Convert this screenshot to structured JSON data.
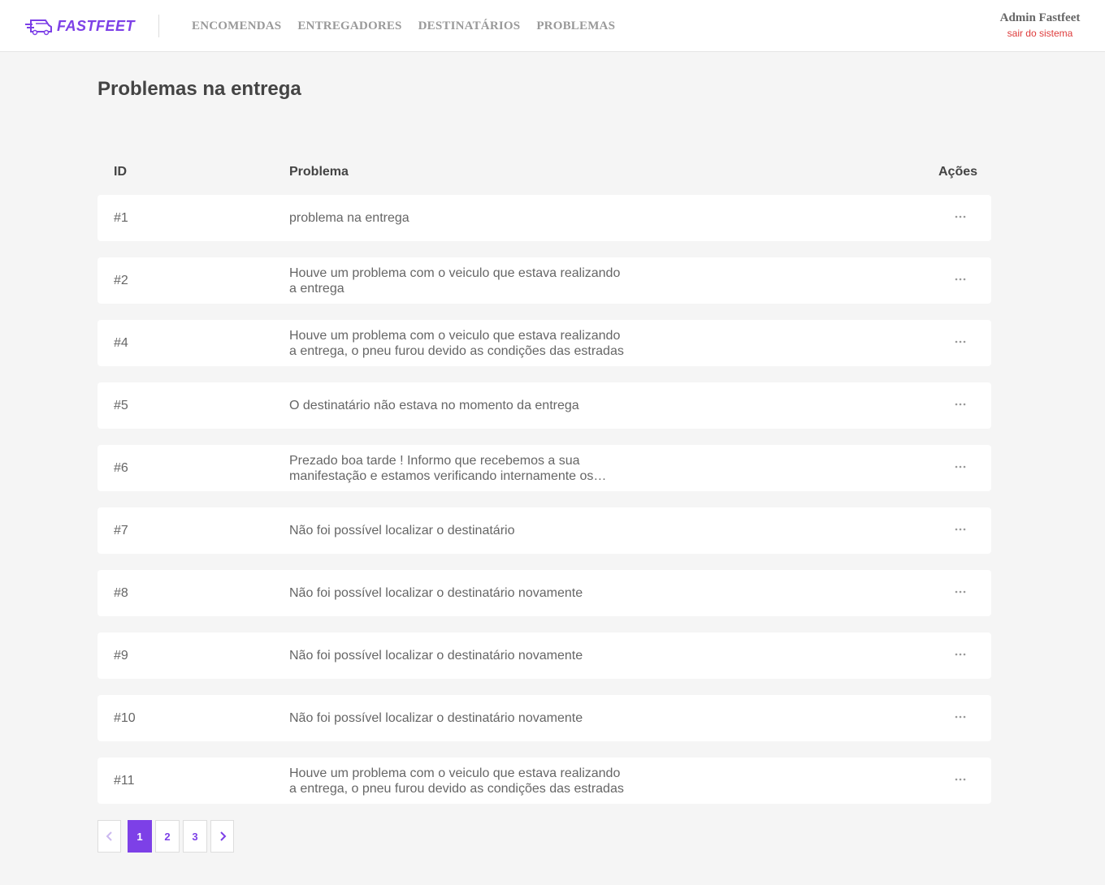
{
  "app": {
    "logo_text": "FASTFEET",
    "brand_color": "#7d40e7"
  },
  "nav": {
    "items": [
      {
        "label": "ENCOMENDAS"
      },
      {
        "label": "ENTREGADORES"
      },
      {
        "label": "DESTINATÁRIOS"
      },
      {
        "label": "PROBLEMAS"
      }
    ]
  },
  "user": {
    "name": "Admin Fastfeet",
    "logout_label": "sair do sistema"
  },
  "page": {
    "title": "Problemas na entrega"
  },
  "table": {
    "headers": {
      "id": "ID",
      "problem": "Problema",
      "actions": "Ações"
    },
    "actions_icon": "more-horizontal-icon",
    "rows": [
      {
        "id": "#1",
        "problem": "problema na entrega"
      },
      {
        "id": "#2",
        "problem": "Houve um problema com o veiculo que estava realizando a entrega"
      },
      {
        "id": "#4",
        "problem": "Houve um problema com o veiculo que estava realizando a entrega, o pneu furou devido as condições das estradas"
      },
      {
        "id": "#5",
        "problem": "O destinatário não estava no momento da entrega"
      },
      {
        "id": "#6",
        "problem": "Prezado boa tarde !   Informo que recebemos a sua manifestação e estamos verificando internamente os…"
      },
      {
        "id": "#7",
        "problem": "Não foi possível localizar o destinatário"
      },
      {
        "id": "#8",
        "problem": "Não foi possível localizar o destinatário novamente"
      },
      {
        "id": "#9",
        "problem": "Não foi possível localizar o destinatário novamente"
      },
      {
        "id": "#10",
        "problem": "Não foi possível localizar o destinatário novamente"
      },
      {
        "id": "#11",
        "problem": "Houve um problema com o veiculo que estava realizando a entrega, o pneu furou devido as condições das estradas"
      }
    ]
  },
  "pagination": {
    "pages": [
      "1",
      "2",
      "3"
    ],
    "current": "1",
    "prev_icon": "chevron-left-icon",
    "next_icon": "chevron-right-icon"
  }
}
